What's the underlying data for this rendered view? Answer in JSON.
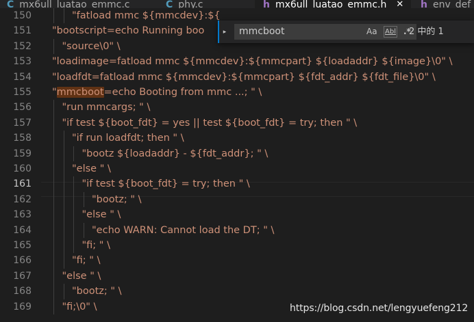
{
  "tabs": [
    {
      "icon": "C",
      "label": "mx6ull_luatao_emmc.c",
      "active": false
    },
    {
      "icon": "C",
      "label": "phy.c",
      "active": false
    },
    {
      "icon": "h",
      "label": "mx6ull_luatao_emmc.h",
      "active": true,
      "close": "✕"
    },
    {
      "icon": "h",
      "label": "env_def",
      "active": false
    }
  ],
  "find": {
    "toggle": "▸",
    "value": "mmcboot",
    "match_case": "Aa",
    "whole_word": "Abl",
    "regex": ".*",
    "count": "2 中的 1"
  },
  "editor": {
    "current_line": "161",
    "lines": [
      {
        "num": "150",
        "text": "\"fatload mmc ${mmcdev}:${"
      },
      {
        "num": "151",
        "text": "\"bootscript=echo Running boo"
      },
      {
        "num": "152",
        "text": "\"source\\0\" \\"
      },
      {
        "num": "153",
        "text": "\"loadimage=fatload mmc ${mmcdev}:${mmcpart} ${loadaddr} ${image}\\0\" \\"
      },
      {
        "num": "154",
        "text": "\"loadfdt=fatload mmc ${mmcdev}:${mmcpart} ${fdt_addr} ${fdt_file}\\0\" \\"
      },
      {
        "num": "155",
        "pre": "\"",
        "match": "mmcboot",
        "text": "=echo Booting from mmc ...; \" \\"
      },
      {
        "num": "156",
        "text": "\"run mmcargs; \" \\"
      },
      {
        "num": "157",
        "text": "\"if test ${boot_fdt} = yes || test ${boot_fdt} = try; then \" \\"
      },
      {
        "num": "158",
        "text": "\"if run loadfdt; then \" \\"
      },
      {
        "num": "159",
        "text": "\"bootz ${loadaddr} - ${fdt_addr}; \" \\"
      },
      {
        "num": "160",
        "text": "\"else \" \\"
      },
      {
        "num": "161",
        "text": "\"if test ${boot_fdt} = try; then \" \\"
      },
      {
        "num": "162",
        "text": "\"bootz; \" \\"
      },
      {
        "num": "163",
        "text": "\"else \" \\"
      },
      {
        "num": "164",
        "text": "\"echo WARN: Cannot load the DT; \" \\"
      },
      {
        "num": "165",
        "text": "\"fi; \" \\"
      },
      {
        "num": "166",
        "text": "\"fi; \" \\"
      },
      {
        "num": "167",
        "text": "\"else \" \\"
      },
      {
        "num": "168",
        "text": "\"bootz; \" \\"
      },
      {
        "num": "169",
        "text": "\"fi;\\0\" \\"
      }
    ]
  },
  "watermark": "https://blog.csdn.net/lengyuefeng212",
  "colors": {
    "background": "#1e1e1e",
    "string": "#ce9178",
    "line_number": "#858585",
    "find_match": "#613214",
    "accent": "#007acc"
  }
}
